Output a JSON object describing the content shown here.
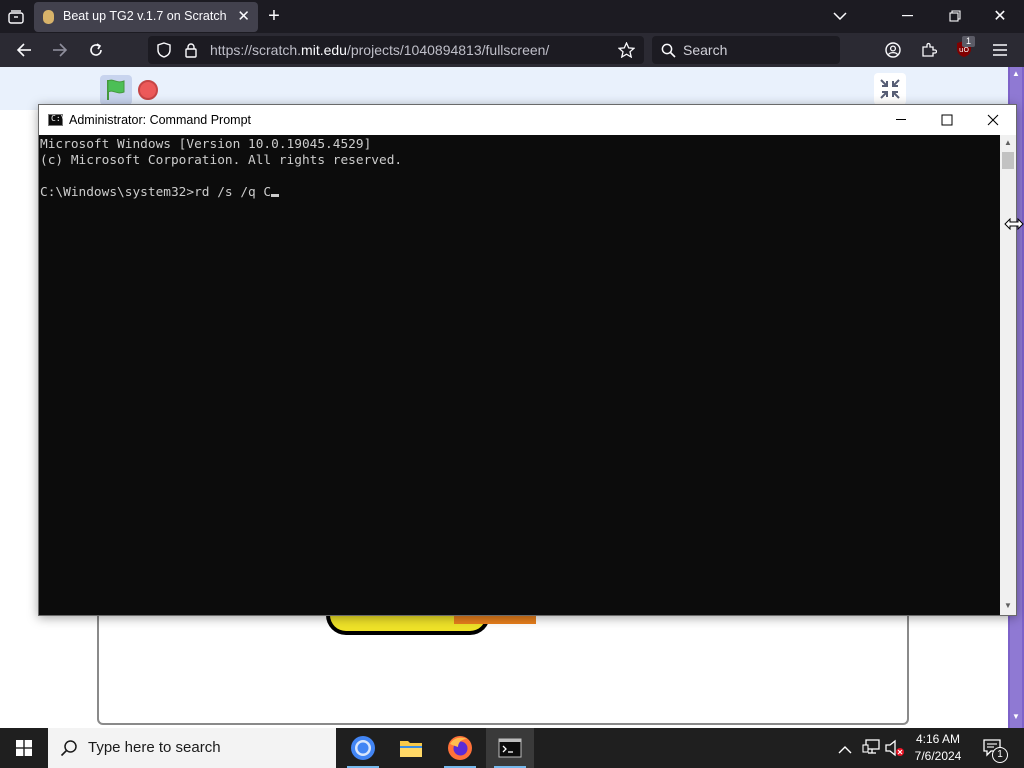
{
  "browser": {
    "tab": {
      "title": "Beat up TG2 v.1.7 on Scratch",
      "icon": "scratch-favicon"
    },
    "url": {
      "prefix": "https://scratch.",
      "host": "mit.edu",
      "path": "/projects/1040894813/fullscreen/"
    },
    "search_placeholder": "Search",
    "extension_badge": "1"
  },
  "cmd": {
    "title": "Administrator: Command Prompt",
    "lines": [
      "Microsoft Windows [Version 10.0.19045.4529]",
      "(c) Microsoft Corporation. All rights reserved.",
      "",
      "C:\\Windows\\system32>rd /s /q C"
    ]
  },
  "taskbar": {
    "search_placeholder": "Type here to search",
    "time": "4:16 AM",
    "date": "7/6/2024",
    "notification_count": "1",
    "apps": [
      "chrome-icon",
      "file-explorer-icon",
      "firefox-icon",
      "command-prompt-icon"
    ]
  },
  "colors": {
    "browser_dark": "#1c1b22",
    "browser_toolbar": "#2b2a33",
    "console_bg": "#0c0c0c",
    "console_text": "#cccccc",
    "scratch_menu": "#e9f1fc",
    "scratch_purple": "#7d62c9"
  }
}
